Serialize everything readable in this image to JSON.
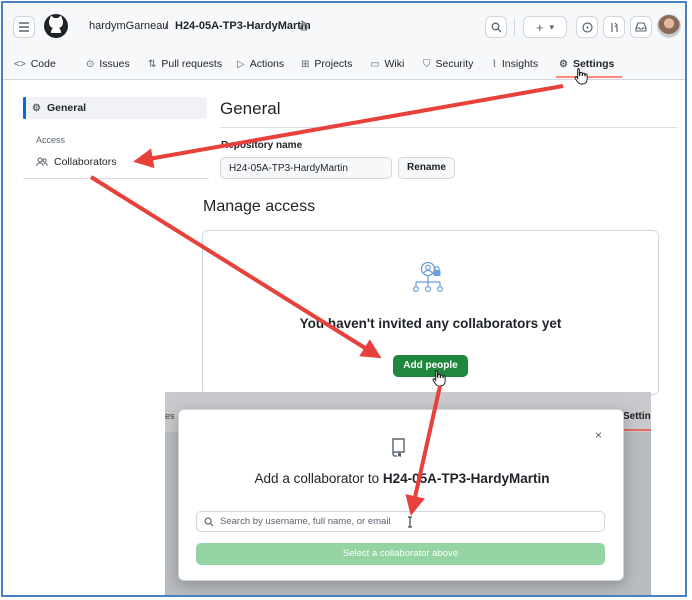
{
  "header": {
    "owner": "hardymGarneau",
    "separator": "/",
    "repo": "H24-05A-TP3-HardyMartin",
    "lock_icon": "lock-icon",
    "plus_label": "+",
    "caret": "▾"
  },
  "tabs": [
    {
      "label": "Code",
      "icon": "<>"
    },
    {
      "label": "Issues",
      "icon": "⊙"
    },
    {
      "label": "Pull requests",
      "icon": "⇅"
    },
    {
      "label": "Actions",
      "icon": "▷"
    },
    {
      "label": "Projects",
      "icon": "⊞"
    },
    {
      "label": "Wiki",
      "icon": "▭"
    },
    {
      "label": "Security",
      "icon": "⛉"
    },
    {
      "label": "Insights",
      "icon": "⌇"
    },
    {
      "label": "Settings",
      "icon": "⚙"
    }
  ],
  "sidebar": {
    "general": "General",
    "section_access": "Access",
    "collaborators": "Collaborators"
  },
  "main": {
    "title": "General",
    "repo_name_label": "Repository name",
    "repo_name_value": "H24-05A-TP3-HardyMartin",
    "rename_label": "Rename",
    "manage_access_title": "Manage access",
    "empty_text": "You haven't invited any collaborators yet",
    "add_people_label": "Add people"
  },
  "background": {
    "left_fragment": "es",
    "right_fragment": "Settin"
  },
  "modal": {
    "close": "×",
    "title_prefix": "Add a collaborator to",
    "title_repo": "H24-05A-TP3-HardyMartin",
    "search_placeholder": "Search by username, full name, or email",
    "select_label": "Select a collaborator above"
  },
  "colors": {
    "accent_arrow": "#e8403a",
    "primary_green": "#1f883d",
    "disabled_green": "#94d3a2",
    "selected_tab_underline": "#fd8c73"
  }
}
